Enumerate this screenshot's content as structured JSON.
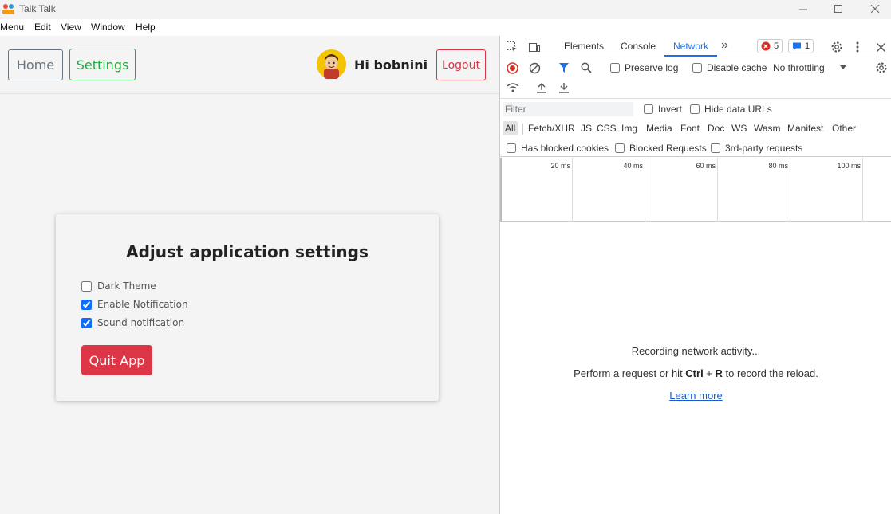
{
  "window": {
    "title": "Talk Talk",
    "controls": {
      "minimize": "—",
      "maximize": "☐",
      "close": "✕"
    }
  },
  "menubar": [
    "Menu",
    "Edit",
    "View",
    "Window",
    "Help"
  ],
  "navbar": {
    "home_label": "Home",
    "settings_label": "Settings",
    "greeting": "Hi bobnini",
    "logout_label": "Logout"
  },
  "settings_card": {
    "title": "Adjust application settings",
    "options": [
      {
        "label": "Dark Theme",
        "checked": false
      },
      {
        "label": "Enable Notification",
        "checked": true
      },
      {
        "label": "Sound notification",
        "checked": true
      }
    ],
    "quit_label": "Quit App"
  },
  "devtools": {
    "tabs": [
      "Elements",
      "Console",
      "Network"
    ],
    "active_tab": "Network",
    "more_tabs": "»",
    "error_count": "5",
    "message_count": "1",
    "toolbar": {
      "preserve_log": "Preserve log",
      "disable_cache": "Disable cache",
      "throttling": "No throttling"
    },
    "filter": {
      "placeholder": "Filter",
      "invert": "Invert",
      "hide_data_urls": "Hide data URLs"
    },
    "types": [
      "All",
      "Fetch/XHR",
      "JS",
      "CSS",
      "Img",
      "Media",
      "Font",
      "Doc",
      "WS",
      "Wasm",
      "Manifest",
      "Other"
    ],
    "blocked": {
      "cookies": "Has blocked cookies",
      "requests": "Blocked Requests",
      "third_party": "3rd-party requests"
    },
    "timeline_ticks": [
      "20 ms",
      "40 ms",
      "60 ms",
      "80 ms",
      "100 ms"
    ],
    "empty": {
      "line1": "Recording network activity...",
      "line2_pre": "Perform a request or hit ",
      "line2_key1": "Ctrl",
      "line2_plus": " + ",
      "line2_key2": "R",
      "line2_post": " to record the reload.",
      "learn_more": "Learn more"
    }
  },
  "colors": {
    "primary_danger": "#dc3545",
    "success": "#28a745",
    "secondary": "#6c757d",
    "devtools_accent": "#1a73e8"
  }
}
